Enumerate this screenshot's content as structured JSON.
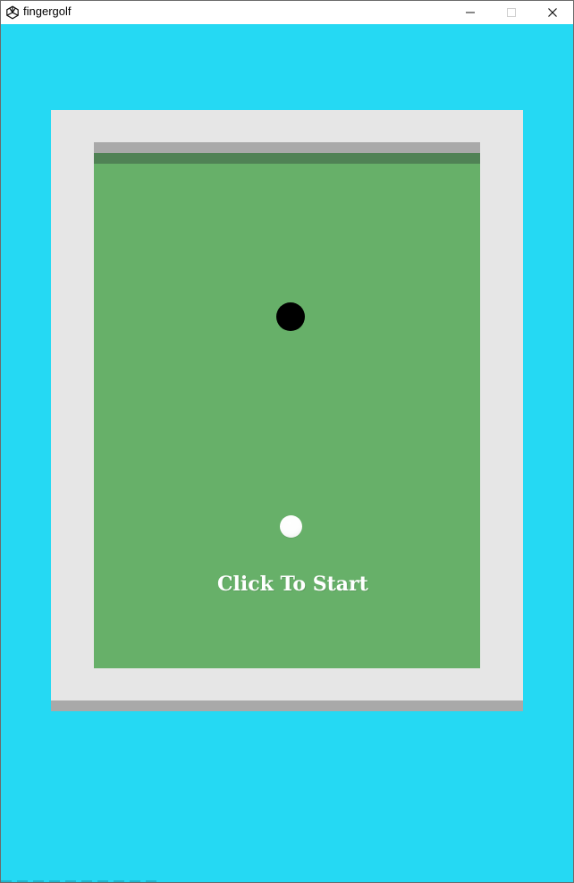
{
  "window": {
    "title": "fingergolf",
    "icons": {
      "app": "unity-icon",
      "minimize": "minimize-icon",
      "maximize": "maximize-icon",
      "close": "close-icon"
    }
  },
  "game": {
    "start_prompt": "Click To Start",
    "colors": {
      "background": "#25d9f3",
      "frame": "#e6e6e6",
      "wall": "#a9a9a9",
      "green": "#67b069",
      "green_shadow": "#508255",
      "hole": "#000000",
      "ball": "#ffffff",
      "text": "#ffffff"
    }
  }
}
